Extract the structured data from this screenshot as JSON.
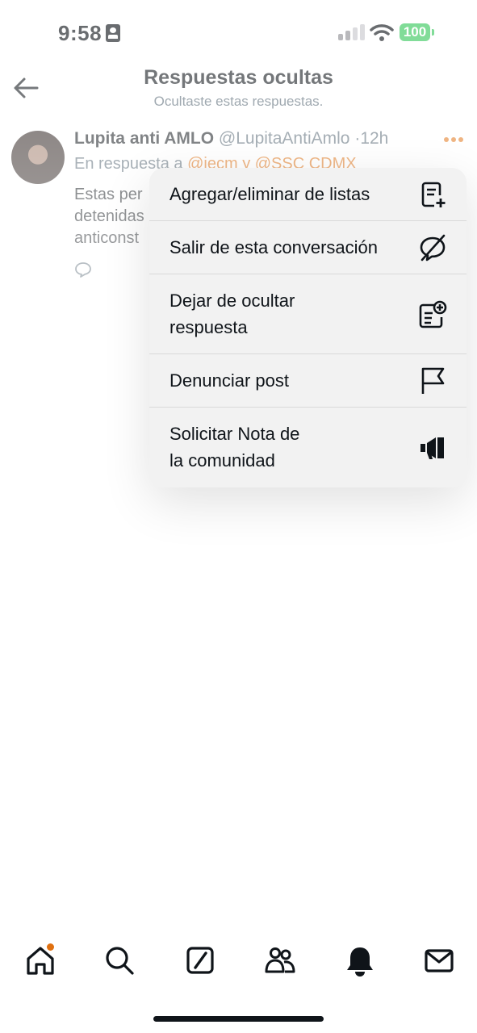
{
  "status_bar": {
    "time": "9:58",
    "battery": "100"
  },
  "header": {
    "title": "Respuestas ocultas",
    "subtitle": "Ocultaste estas respuestas."
  },
  "post": {
    "author_name": "Lupita anti AMLO",
    "handle": "@LupitaAntiAmlo",
    "separator": "·",
    "age": "12h",
    "reply_prefix": "En respuesta a",
    "mention_1": "@iecm",
    "reply_and": "y",
    "mention_2": "@SSC CDMX",
    "text": "Estas per\ndetenidas\nanticonst"
  },
  "menu": {
    "items": [
      {
        "label": "Agregar/eliminar de listas",
        "icon": "list-add-icon"
      },
      {
        "label": "Salir de esta conversación",
        "icon": "mute-conversation-icon"
      },
      {
        "label": "Dejar de ocultar\nrespuesta",
        "icon": "unhide-reply-icon"
      },
      {
        "label": "Denunciar post",
        "icon": "flag-icon"
      },
      {
        "label": "Solicitar Nota de\nla comunidad",
        "icon": "megaphone-icon"
      }
    ]
  },
  "tabbar": {
    "items": [
      "home-icon",
      "search-icon",
      "grok-icon",
      "communities-icon",
      "notifications-icon",
      "messages-icon"
    ]
  },
  "colors": {
    "accent": "#e07010",
    "battery": "#34c759",
    "text": "#0f1419",
    "muted": "#536471"
  }
}
